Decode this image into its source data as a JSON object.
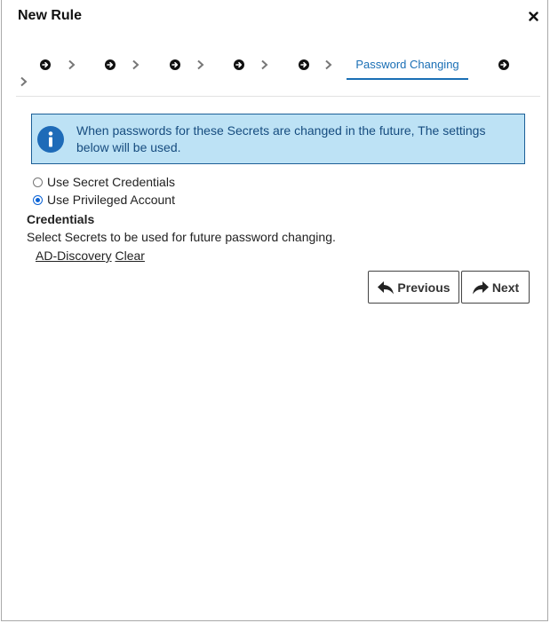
{
  "dialog": {
    "title": "New Rule",
    "close_icon": "close-icon"
  },
  "wizard": {
    "active_step": "Password Changing",
    "step_icon": "arrow-circle-right-icon",
    "separator_icon": "chevron-right-icon"
  },
  "info": {
    "icon": "info-icon",
    "message": "When passwords for these Secrets are changed in the future, The settings below will be used."
  },
  "options": [
    {
      "label": "Use Secret Credentials",
      "selected": false
    },
    {
      "label": "Use Privileged Account",
      "selected": true
    }
  ],
  "credentials": {
    "title": "Credentials",
    "help": "Select Secrets to be used for future password changing.",
    "selected_secret": "AD-Discovery",
    "clear_label": "Clear"
  },
  "buttons": {
    "previous_label": "Previous",
    "next_label": "Next"
  },
  "colors": {
    "accent": "#1a6fb5",
    "info_bg": "#bde2f5",
    "info_border": "#1d5f97"
  }
}
